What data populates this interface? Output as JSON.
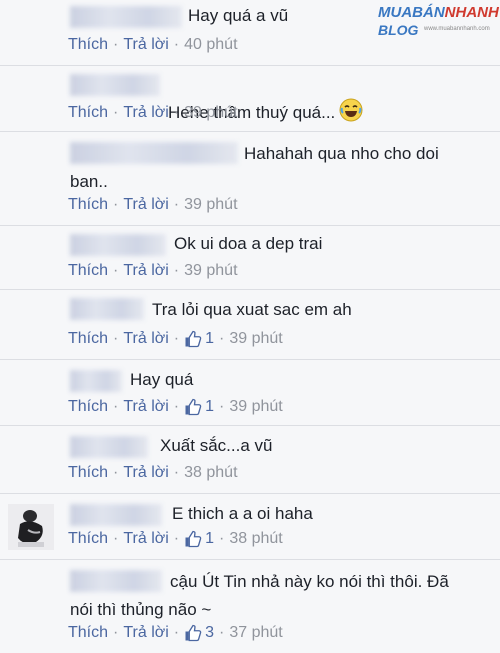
{
  "watermark": {
    "brand_a": "MUA",
    "brand_b": "BÁN",
    "brand_c": "NHANH",
    "sub": "BLOG",
    "small": "www.muabannhanh.com"
  },
  "actions": {
    "like_label": "Thích",
    "reply_label": "Trả lời",
    "separator": "·"
  },
  "comments": [
    {
      "text": "Hay quá a vũ",
      "time": "40 phút",
      "likes": ""
    },
    {
      "text": "Hehe thâm thuý quá...",
      "time": "39 phút",
      "likes": ""
    },
    {
      "text": "Hahahah qua nho cho doi\nban..",
      "time": "39 phút",
      "likes": ""
    },
    {
      "text": "Ok ui doa a dep trai",
      "time": "39 phút",
      "likes": ""
    },
    {
      "text": "Tra lỏi qua xuat sac em ah",
      "time": "39 phút",
      "likes": "1"
    },
    {
      "text": "Hay quá",
      "time": "39 phút",
      "likes": "1"
    },
    {
      "text": "Xuất sắc...a vũ",
      "time": "38 phút",
      "likes": ""
    },
    {
      "text": "E thich a a oi haha",
      "time": "38 phút",
      "likes": "1"
    },
    {
      "text": "cậu Út Tin nhả này ko nói thì thôi. Đã\nnói thì thủng não ~",
      "time": "37 phút",
      "likes": "3"
    }
  ],
  "icons": {
    "like": "thumbs-up-icon",
    "emoji": "laughing-emoji-icon"
  },
  "colors": {
    "link": "#4b67a1",
    "meta": "#90949c",
    "text": "#1d2129",
    "background": "#f6f7f9"
  }
}
